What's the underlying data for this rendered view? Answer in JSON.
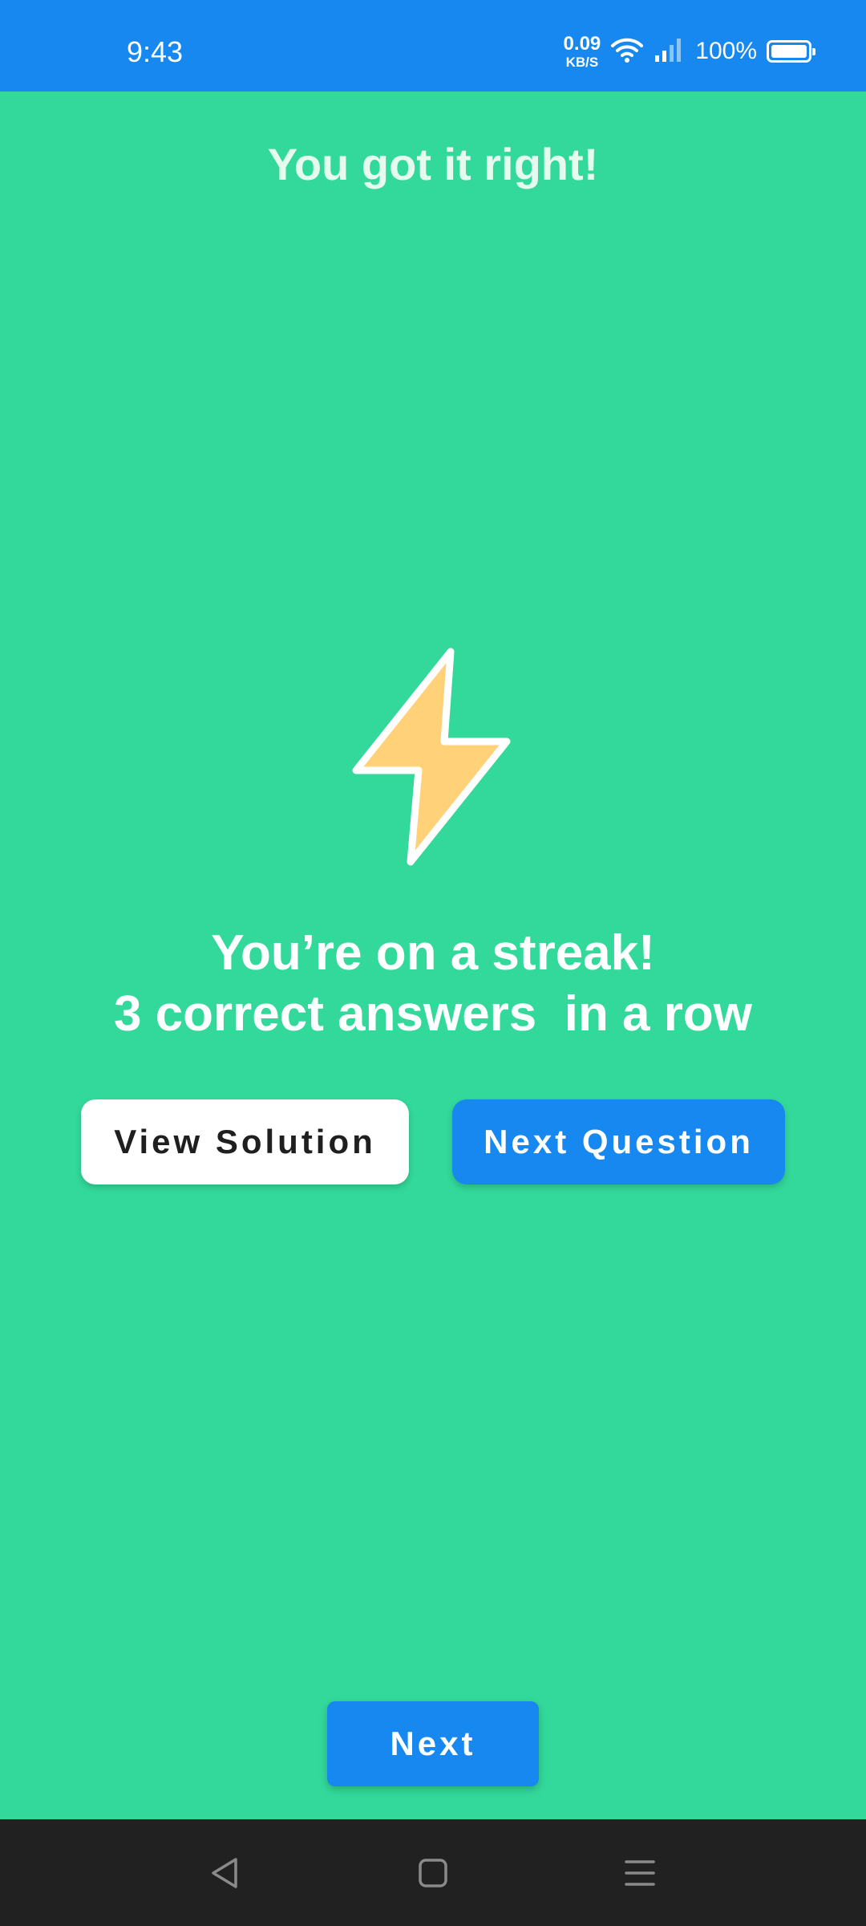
{
  "status_bar": {
    "time": "9:43",
    "net_speed_value": "0.09",
    "net_speed_unit": "KB/S",
    "battery_percent": "100%",
    "icons": [
      "wifi-icon",
      "signal-icon",
      "battery-icon"
    ]
  },
  "header": {
    "title": "You got it right!"
  },
  "streak": {
    "icon": "lightning-bolt-icon",
    "line1": "You’re on a streak!",
    "line2": "3 correct answers  in a row"
  },
  "actions": {
    "view_solution_label": "View Solution",
    "next_question_label": "Next Question",
    "next_label": "Next"
  },
  "nav_bar": {
    "icons": [
      "back-icon",
      "home-icon",
      "menu-icon"
    ]
  },
  "colors": {
    "background": "#33D99A",
    "primary": "#1688EF",
    "bolt_fill": "#FFD27A",
    "nav_bar": "#212121"
  }
}
